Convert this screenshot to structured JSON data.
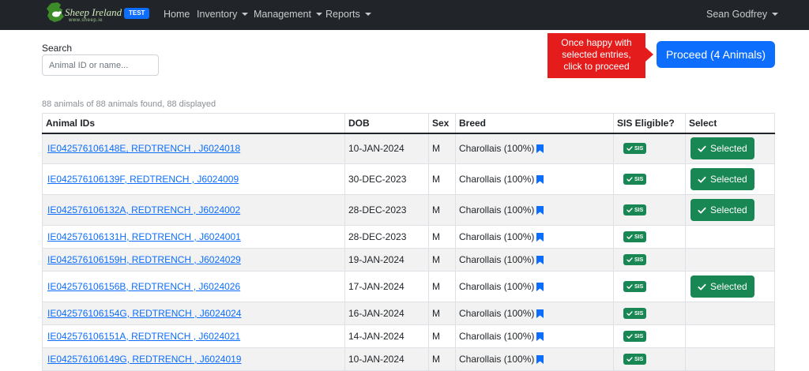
{
  "navbar": {
    "logo_text": "Sheep Ireland",
    "logo_url": "www.sheep.ie",
    "badge": "TEST",
    "items": [
      {
        "label": "Home",
        "dropdown": false
      },
      {
        "label": "Inventory",
        "dropdown": true
      },
      {
        "label": "Management",
        "dropdown": true
      },
      {
        "label": "Reports",
        "dropdown": true
      }
    ],
    "user": "Sean Godfrey"
  },
  "search": {
    "label": "Search",
    "placeholder": "Animal ID or name..."
  },
  "callout": {
    "line1": "Once happy with",
    "line2": "selected entries,",
    "line3": "click to proceed"
  },
  "proceed_button": "Proceed (4 Animals)",
  "found_text": "88 animals of 88 animals found, 88 displayed",
  "table": {
    "headers": [
      "Animal IDs",
      "DOB",
      "Sex",
      "Breed",
      "SIS Eligible?",
      "Select"
    ],
    "rows": [
      {
        "id": "IE042576106148E, REDTRENCH , J6024018",
        "dob": "10-JAN-2024",
        "sex": "M",
        "breed": "Charollais (100%)",
        "sis": "SIS",
        "selected": true
      },
      {
        "id": "IE042576106139F, REDTRENCH , J6024009",
        "dob": "30-DEC-2023",
        "sex": "M",
        "breed": "Charollais (100%)",
        "sis": "SIS",
        "selected": true
      },
      {
        "id": "IE042576106132A, REDTRENCH , J6024002",
        "dob": "28-DEC-2023",
        "sex": "M",
        "breed": "Charollais (100%)",
        "sis": "SIS",
        "selected": true
      },
      {
        "id": "IE042576106131H, REDTRENCH , J6024001",
        "dob": "28-DEC-2023",
        "sex": "M",
        "breed": "Charollais (100%)",
        "sis": "SIS",
        "selected": false
      },
      {
        "id": "IE042576106159H, REDTRENCH , J6024029",
        "dob": "19-JAN-2024",
        "sex": "M",
        "breed": "Charollais (100%)",
        "sis": "SIS",
        "selected": false
      },
      {
        "id": "IE042576106156B, REDTRENCH , J6024026",
        "dob": "17-JAN-2024",
        "sex": "M",
        "breed": "Charollais (100%)",
        "sis": "SIS",
        "selected": true
      },
      {
        "id": "IE042576106154G, REDTRENCH , J6024024",
        "dob": "16-JAN-2024",
        "sex": "M",
        "breed": "Charollais (100%)",
        "sis": "SIS",
        "selected": false
      },
      {
        "id": "IE042576106151A, REDTRENCH , J6024021",
        "dob": "14-JAN-2024",
        "sex": "M",
        "breed": "Charollais (100%)",
        "sis": "SIS",
        "selected": false
      },
      {
        "id": "IE042576106149G, REDTRENCH , J6024019",
        "dob": "10-JAN-2024",
        "sex": "M",
        "breed": "Charollais (100%)",
        "sis": "SIS",
        "selected": false
      }
    ],
    "selected_label": "Selected"
  },
  "colors": {
    "navbar": "#212529",
    "primary": "#0d6efd",
    "success": "#198754",
    "callout": "#e51c1c"
  },
  "icons": {
    "breed": "bookmark-icon",
    "sis": "check-icon",
    "selected": "check-icon",
    "nav_dropdown": "caret-down-icon"
  }
}
